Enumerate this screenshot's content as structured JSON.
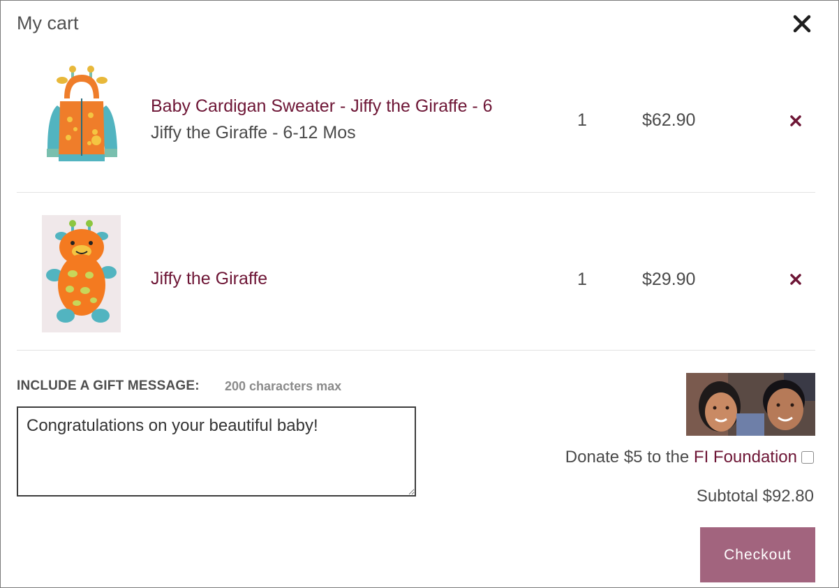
{
  "cart": {
    "title": "My cart",
    "close_icon": "close-icon"
  },
  "items": [
    {
      "name": "Baby Cardigan Sweater - Jiffy the Giraffe - 6",
      "variant": "Jiffy the Giraffe - 6-12 Mos",
      "quantity": "1",
      "price": "$62.90",
      "image_icon": "cardigan-sweater-image",
      "remove_icon": "remove-icon"
    },
    {
      "name": "Jiffy the Giraffe",
      "variant": "",
      "quantity": "1",
      "price": "$29.90",
      "image_icon": "giraffe-toy-image",
      "remove_icon": "remove-icon"
    }
  ],
  "gift": {
    "label": "INCLUDE A GIFT MESSAGE:",
    "limit": "200 characters max",
    "message": "Congratulations on your beautiful baby!"
  },
  "donation": {
    "prefix": "Donate $5 to the ",
    "foundation": "FI Foundation",
    "checked": false,
    "image_icon": "children-photo"
  },
  "summary": {
    "subtotal": "Subtotal $92.80",
    "checkout_label": "Checkout"
  },
  "colors": {
    "accent": "#6d1535",
    "checkout_bg": "#a2647e",
    "text": "#4a4a4a"
  }
}
